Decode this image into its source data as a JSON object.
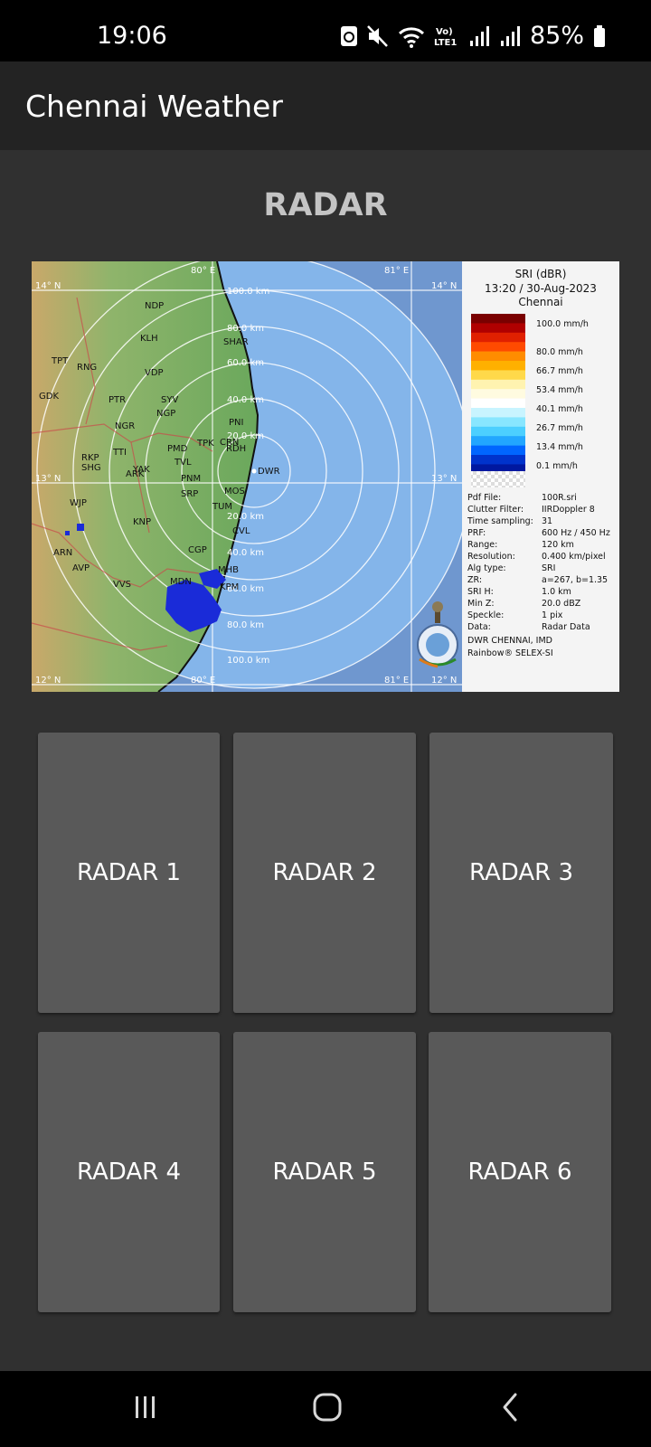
{
  "status_bar": {
    "time": "19:06",
    "battery": "85%"
  },
  "app_bar": {
    "title": "Chennai Weather"
  },
  "section": {
    "title": "RADAR"
  },
  "radar_image": {
    "legend": {
      "product": "SRI (dBR)",
      "timestamp": "13:20 / 30-Aug-2023",
      "station": "Chennai",
      "scale": [
        "100.0 mm/h",
        "80.0 mm/h",
        "66.7 mm/h",
        "53.4 mm/h",
        "40.1 mm/h",
        "26.7 mm/h",
        "13.4 mm/h",
        "0.1 mm/h"
      ],
      "colors": [
        "#7a0000",
        "#b00000",
        "#e02000",
        "#ff4a00",
        "#ff8c00",
        "#ffb000",
        "#ffd94a",
        "#fff3b0",
        "#fffbe0",
        "#ffffff",
        "#c8f4ff",
        "#88e6ff",
        "#4ccfff",
        "#22a6ff",
        "#0066ff",
        "#0033cc",
        "#0018a0"
      ]
    },
    "meta": [
      [
        "Pdf File:",
        "100R.sri"
      ],
      [
        "Clutter Filter:",
        "IIRDoppler 8"
      ],
      [
        "Time sampling:",
        "31"
      ],
      [
        "PRF:",
        "600 Hz / 450 Hz"
      ],
      [
        "Range:",
        "120 km"
      ],
      [
        "Resolution:",
        "0.400 km/pixel"
      ],
      [
        "Alg type:",
        "SRI"
      ],
      [
        "ZR:",
        "a=267, b=1.35"
      ],
      [
        "SRI H:",
        "1.0 km"
      ],
      [
        "Min Z:",
        "20.0 dBZ"
      ],
      [
        "Speckle:",
        "1 pix"
      ],
      [
        "Data:",
        "Radar Data"
      ]
    ],
    "footer1": "DWR CHENNAI, IMD",
    "footer2": "Rainbow® SELEX-SI",
    "range_labels": [
      "100.0 km",
      "80.0 km",
      "60.0 km",
      "40.0 km",
      "20.0 km",
      "20.0 km",
      "40.0 km",
      "60.0 km",
      "80.0 km",
      "100.0 km"
    ],
    "lat_labels": [
      "14° N",
      "14° N",
      "13° N",
      "13° N",
      "12° N",
      "12° N"
    ],
    "lon_labels": [
      "80° E",
      "81° E",
      "80° E",
      "81° E"
    ],
    "center_label": "DWR",
    "places": [
      "NDP",
      "KLH",
      "SHAR",
      "RNG",
      "VDP",
      "GDK",
      "PTR",
      "SYV",
      "NGP",
      "NGR",
      "PNI",
      "TPK",
      "CRN",
      "RDH",
      "PMD",
      "RKP",
      "TTI",
      "TVL",
      "SHG",
      "ARK",
      "PNM",
      "YAK",
      "SRP",
      "MOS",
      "TUM",
      "WJP",
      "KNP",
      "CVL",
      "CGP",
      "ARN",
      "MHB",
      "AVP",
      "VVS",
      "MDN",
      "KPM",
      "TPT"
    ]
  },
  "tiles": [
    "RADAR 1",
    "RADAR 2",
    "RADAR 3",
    "RADAR 4",
    "RADAR 5",
    "RADAR 6"
  ]
}
